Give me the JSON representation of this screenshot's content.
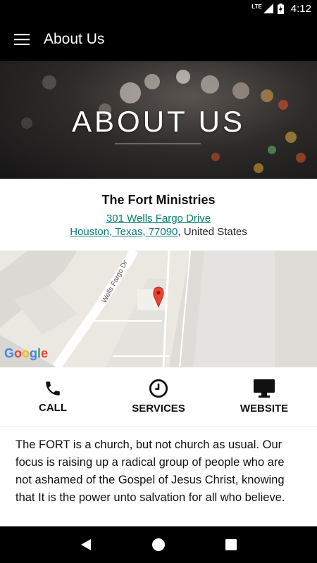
{
  "status_bar": {
    "network": "LTE",
    "time": "4:12"
  },
  "app_bar": {
    "title": "About Us",
    "menu_icon": "hamburger-menu-icon"
  },
  "hero": {
    "title": "ABOUT US"
  },
  "info": {
    "organization": "The Fort Ministries",
    "address_line1": "301 Wells Fargo Drive",
    "address_line2_link": "Houston, Texas, 77090",
    "address_line2_suffix": ", United States"
  },
  "map": {
    "street_label": "Wells Fargo Dr",
    "attribution": "Google",
    "pin_color": "#ea4335"
  },
  "actions": [
    {
      "label": "CALL",
      "icon": "phone-icon"
    },
    {
      "label": "SERVICES",
      "icon": "clock-icon"
    },
    {
      "label": "WEBSITE",
      "icon": "monitor-icon"
    }
  ],
  "description": "The FORT is a church, but not church as usual. Our focus is raising up a radical group of people who are not ashamed of the Gospel of Jesus Christ, knowing that It is the power unto salvation for all who believe.",
  "nav": {
    "back": "back-icon",
    "home": "home-icon",
    "recents": "recents-icon"
  },
  "colors": {
    "link": "#0b7d73",
    "bar": "#000000"
  }
}
